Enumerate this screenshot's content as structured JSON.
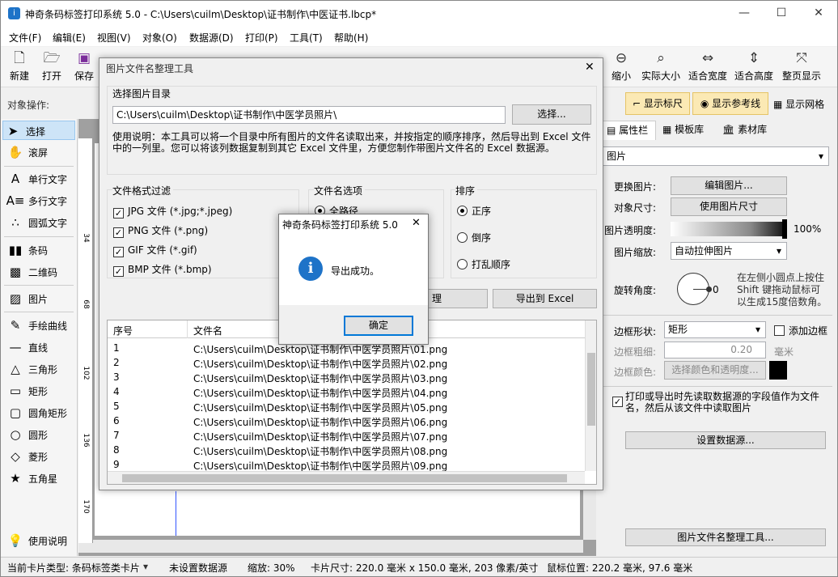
{
  "window": {
    "title": "神奇条码标签打印系统 5.0 - C:\\Users\\cuilm\\Desktop\\证书制作\\中医证书.lbcp*",
    "logo_glyph": "i"
  },
  "menu": [
    "文件(F)",
    "编辑(E)",
    "视图(V)",
    "对象(O)",
    "数据源(D)",
    "打印(P)",
    "工具(T)",
    "帮助(H)"
  ],
  "toolbar": {
    "new": "新建",
    "open": "打开",
    "save": "保存",
    "zoom_out": "缩小",
    "actual_size": "实际大小",
    "fit_width": "适合宽度",
    "fit_height": "适合高度",
    "fit_page": "整页显示"
  },
  "ops_bar": {
    "label": "对象操作:",
    "show_ruler": "显示标尺",
    "show_guides": "显示参考线",
    "show_grid": "显示网格"
  },
  "left_tools": [
    {
      "label": "选择",
      "icon": "arrow-icon"
    },
    {
      "label": "滚屏",
      "icon": "hand-icon"
    },
    {
      "label": "单行文字",
      "icon": "text-single-icon"
    },
    {
      "label": "多行文字",
      "icon": "text-multi-icon"
    },
    {
      "label": "圆弧文字",
      "icon": "text-arc-icon"
    },
    {
      "label": "条码",
      "icon": "barcode-icon"
    },
    {
      "label": "二维码",
      "icon": "qrcode-icon"
    },
    {
      "label": "图片",
      "icon": "picture-icon"
    },
    {
      "label": "手绘曲线",
      "icon": "pen-icon"
    },
    {
      "label": "直线",
      "icon": "line-icon"
    },
    {
      "label": "三角形",
      "icon": "triangle-icon"
    },
    {
      "label": "矩形",
      "icon": "rectangle-icon"
    },
    {
      "label": "圆角矩形",
      "icon": "rounded-rect-icon"
    },
    {
      "label": "圆形",
      "icon": "circle-icon"
    },
    {
      "label": "菱形",
      "icon": "diamond-icon"
    },
    {
      "label": "五角星",
      "icon": "star-icon"
    }
  ],
  "help_label": "使用说明",
  "ruler_marks": [
    "34",
    "68",
    "102",
    "136",
    "170"
  ],
  "right_panel": {
    "tabs": [
      "属性栏",
      "模板库",
      "素材库"
    ],
    "object_type": "图片",
    "replace_image_label": "更换图片:",
    "edit_image_btn": "编辑图片...",
    "object_size_label": "对象尺寸:",
    "use_image_size_btn": "使用图片尺寸",
    "transparency_label": "图片透明度:",
    "transparency_value": "100%",
    "scale_label": "图片缩放:",
    "scale_value": "自动拉伸图片",
    "rotation_label": "旋转角度:",
    "rotation_value": "0",
    "rotation_hint": "在左侧小圆点上按住Shift 键拖动鼠标可以生成15度倍数角。",
    "border_shape_label": "边框形状:",
    "border_shape_value": "矩形",
    "add_border_label": "添加边框",
    "border_width_label": "边框粗细:",
    "border_width_value": "0.20",
    "border_unit": "毫米",
    "border_color_label": "边框颜色:",
    "choose_color_btn": "选择颜色和透明度...",
    "read_from_data_label": "打印或导出时先读取数据源的字段值作为文件名，然后从该文件中读取图片",
    "set_datasource_btn": "设置数据源...",
    "file_tool_btn": "图片文件名整理工具..."
  },
  "status_bar": {
    "card_type": "当前卡片类型:  条码标签类卡片",
    "datasource": "未设置数据源",
    "zoom": "缩放:  30%",
    "card_size": "卡片尺寸:  220.0 毫米 x 150.0 毫米, 203 像素/英寸",
    "mouse_pos": "鼠标位置:  220.2 毫米, 97.6 毫米"
  },
  "dialog": {
    "title": "图片文件名整理工具",
    "dir_label": "选择图片目录",
    "dir_value": "C:\\Users\\cuilm\\Desktop\\证书制作\\中医学员照片\\",
    "choose_btn": "选择...",
    "instructions": "使用说明：本工具可以将一个目录中所有图片的文件名读取出来，并按指定的顺序排序，然后导出到 Excel 文件中的一列里。您可以将该列数据复制到其它 Excel 文件里，方便您制作带图片文件名的 Excel 数据源。",
    "filter_label": "文件格式过滤",
    "filters": [
      "JPG 文件 (*.jpg;*.jpeg)",
      "PNG 文件 (*.png)",
      "GIF 文件 (*.gif)",
      "BMP 文件 (*.bmp)"
    ],
    "name_opt_label": "文件名选项",
    "name_opt_full": "全路径",
    "sort_label": "排序",
    "sort_options": [
      "正序",
      "倒序",
      "打乱顺序"
    ],
    "organize_btn_tail": "理",
    "export_btn": "导出到 Excel",
    "grid_headers": [
      "序号",
      "文件名"
    ],
    "rows": [
      [
        "1",
        "C:\\Users\\cuilm\\Desktop\\证书制作\\中医学员照片\\01.png"
      ],
      [
        "2",
        "C:\\Users\\cuilm\\Desktop\\证书制作\\中医学员照片\\02.png"
      ],
      [
        "3",
        "C:\\Users\\cuilm\\Desktop\\证书制作\\中医学员照片\\03.png"
      ],
      [
        "4",
        "C:\\Users\\cuilm\\Desktop\\证书制作\\中医学员照片\\04.png"
      ],
      [
        "5",
        "C:\\Users\\cuilm\\Desktop\\证书制作\\中医学员照片\\05.png"
      ],
      [
        "6",
        "C:\\Users\\cuilm\\Desktop\\证书制作\\中医学员照片\\06.png"
      ],
      [
        "7",
        "C:\\Users\\cuilm\\Desktop\\证书制作\\中医学员照片\\07.png"
      ],
      [
        "8",
        "C:\\Users\\cuilm\\Desktop\\证书制作\\中医学员照片\\08.png"
      ],
      [
        "9",
        "C:\\Users\\cuilm\\Desktop\\证书制作\\中医学员照片\\09.png"
      ]
    ]
  },
  "message_box": {
    "title": "神奇条码标签打印系统 5.0",
    "message": "导出成功。",
    "ok_btn": "确定",
    "icon_glyph": "i"
  },
  "colors": {
    "accent": "#1e73c8",
    "highlight_btn": "#fbe9b4"
  }
}
